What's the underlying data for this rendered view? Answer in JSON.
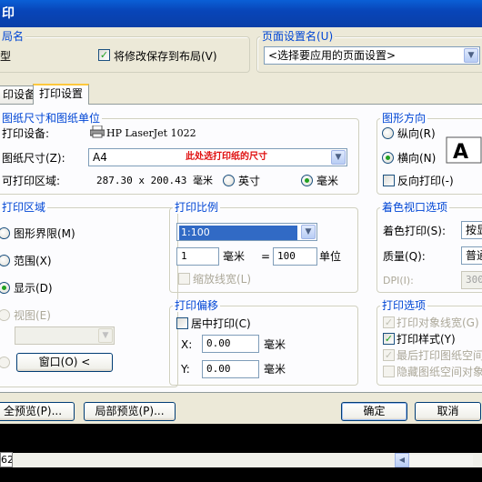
{
  "window": {
    "title": "印"
  },
  "layout_group": {
    "title": "局名",
    "partial_text": "型",
    "save_changes_label": "将修改保存到布局(V)",
    "save_changes_checked": true
  },
  "page_setup_group": {
    "title": "页面设置名(U)",
    "select_value": "<选择要应用的页面设置>"
  },
  "tabs": [
    {
      "label": "印设备",
      "active": false
    },
    {
      "label": "打印设置",
      "active": true
    }
  ],
  "paper": {
    "title": "图纸尺寸和图纸单位",
    "device_label": "打印设备:",
    "device_value": "HP LaserJet 1022",
    "size_label": "图纸尺寸(Z):",
    "size_value": "A4",
    "size_annotation": "此处选打印纸的尺寸",
    "area_label": "可打印区域:",
    "area_value": "287.30 x 200.43 毫米",
    "unit_inch": "英寸",
    "unit_mm": "毫米",
    "selected_unit": "mm"
  },
  "orientation": {
    "title": "图形方向",
    "portrait": "纵向(R)",
    "landscape": "横向(N)",
    "reverse": "反向打印(-)",
    "selected": "landscape",
    "reverse_checked": false
  },
  "plot_area": {
    "title": "打印区域",
    "limits": "图形界限(M)",
    "extents": "范围(X)",
    "display": "显示(D)",
    "view": "视图(E)",
    "window_button": "窗口(O) <",
    "selected": "display"
  },
  "plot_scale": {
    "title": "打印比例",
    "scale_value": "1:100",
    "value1": "1",
    "unit_mm": "毫米",
    "equals": "=",
    "value2": "100",
    "unit": "单位",
    "scale_lineweights": "缩放线宽(L)"
  },
  "plot_offset": {
    "title": "打印偏移",
    "center": "居中打印(C)",
    "x_label": "X:",
    "x_value": "0.00",
    "x_unit": "毫米",
    "y_label": "Y:",
    "y_value": "0.00",
    "y_unit": "毫米"
  },
  "shaded_viewport": {
    "title": "着色视口选项",
    "shade_label": "着色打印(S):",
    "shade_value": "按显",
    "quality_label": "质量(Q):",
    "quality_value": "普通",
    "dpi_label": "DPI(I):",
    "dpi_value": "300"
  },
  "plot_options": {
    "title": "打印选项",
    "items": [
      {
        "label": "打印对象线宽(G)",
        "checked": true,
        "disabled": true
      },
      {
        "label": "打印样式(Y)",
        "checked": true,
        "disabled": false
      },
      {
        "label": "最后打印图纸空间",
        "checked": true,
        "disabled": true
      },
      {
        "label": "隐藏图纸空间对象",
        "checked": false,
        "disabled": true
      }
    ]
  },
  "buttons": {
    "full_preview": "全预览(P)...",
    "partial_preview": "局部预览(P)...",
    "ok": "确定",
    "cancel": "取消"
  },
  "statusbar": {
    "sheet_tab": "62"
  }
}
